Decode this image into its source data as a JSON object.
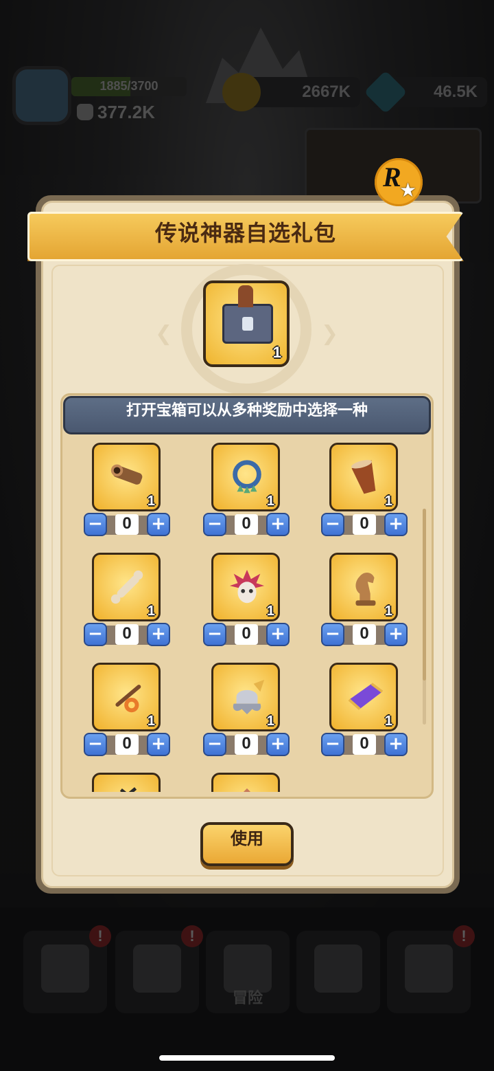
{
  "hud": {
    "level_progress": "1885/3700",
    "level_fraction": 0.51,
    "power": "377.2K",
    "gold": "2667K",
    "gems": "46.5K"
  },
  "bottom_nav": {
    "items": [
      {
        "icon": "shield-pen-icon",
        "badge": "!",
        "label": ""
      },
      {
        "icon": "helmet-icon",
        "badge": "!",
        "label": ""
      },
      {
        "icon": "crossed-swords-icon",
        "badge": "",
        "label": "冒险"
      },
      {
        "icon": "target-icon",
        "badge": "",
        "label": ""
      },
      {
        "icon": "trophy-icon",
        "badge": "!",
        "label": ""
      }
    ]
  },
  "modal": {
    "title": "传说神器自选礼包",
    "chest": {
      "icon": "artifact-chest-icon",
      "count": "1"
    },
    "instruction": "打开宝箱可以从多种奖励中选择一种",
    "items": [
      {
        "icon": "spyglass-cannon-icon",
        "count": "1",
        "qty": "0"
      },
      {
        "icon": "bell-necklace-icon",
        "count": "1",
        "qty": "0"
      },
      {
        "icon": "drum-icon",
        "count": "1",
        "qty": "0"
      },
      {
        "icon": "bone-club-icon",
        "count": "1",
        "qty": "0"
      },
      {
        "icon": "feather-mask-icon",
        "count": "1",
        "qty": "0"
      },
      {
        "icon": "knight-chess-icon",
        "count": "1",
        "qty": "0"
      },
      {
        "icon": "lantern-staff-icon",
        "count": "1",
        "qty": "0"
      },
      {
        "icon": "winged-helmet-icon",
        "count": "1",
        "qty": "0"
      },
      {
        "icon": "magic-carpet-icon",
        "count": "1",
        "qty": "0"
      }
    ],
    "minus_label": "−",
    "plus_label": "+",
    "use_button": "使用"
  },
  "colors": {
    "modal_bg": "#efe3c8",
    "ribbon": "#f6ca5c",
    "card_gold": "#f0b12c",
    "stepper_blue": "#3f72d4",
    "header_slate": "#4a5870"
  }
}
